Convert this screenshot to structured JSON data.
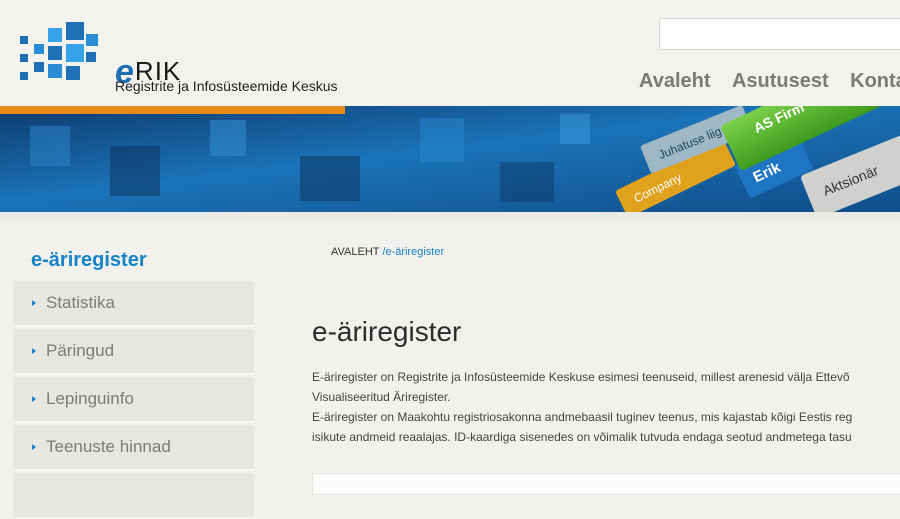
{
  "header": {
    "logo_text": "RIK",
    "logo_letter": "e",
    "logo_subtitle": "Registrite ja Infosüsteemide Keskus",
    "search": {
      "value": "",
      "placeholder": ""
    },
    "nav": [
      "Avaleht",
      "Asutusest",
      "Kontakt"
    ]
  },
  "banner": {
    "tiles": [
      "Juhatuse liig",
      "AS Firm",
      "Company",
      "Erik",
      "Aktsionär"
    ]
  },
  "sidebar": {
    "title": "e-äriregister",
    "items": [
      "Statistika",
      "Päringud",
      "Lepinguinfo",
      "Teenuste hinnad"
    ]
  },
  "breadcrumb": {
    "home": "AVALEHT",
    "separator": " /",
    "current": "e-äriregister"
  },
  "main": {
    "title": "e-äriregister",
    "lines": [
      "E-äriregister on Registrite ja Infosüsteemide Keskuse esimesi teenuseid, millest arenesid välja Ettevõ",
      "Visualiseeritud Äriregister.",
      "E-äriregister on Maakohtu registriosakonna andmebaasil tuginev teenus, mis kajastab kõigi Eestis reg",
      "isikute andmeid reaalajas. ID-kaardiga sisenedes on võimalik tutvuda endaga seotud andmetega tasu"
    ]
  },
  "colors": {
    "accent": "#1583c7",
    "nav_text": "#7a7a76",
    "banner_orange": "#e88a1a"
  }
}
